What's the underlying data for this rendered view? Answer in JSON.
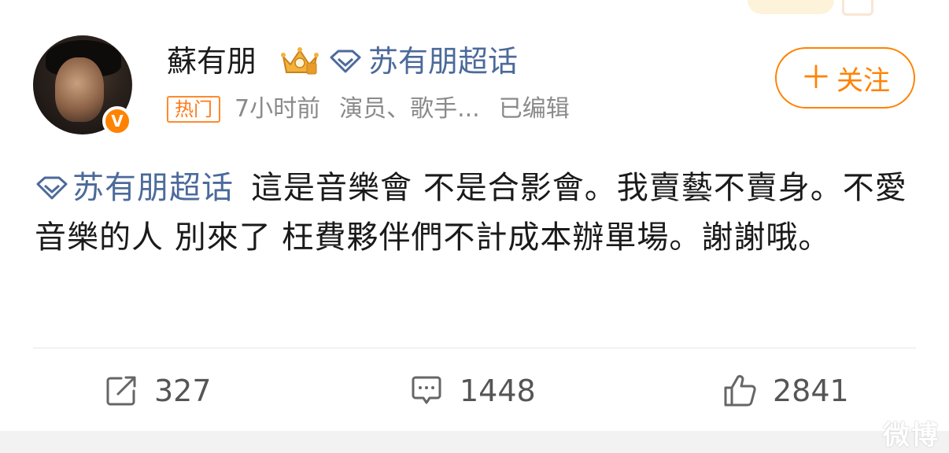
{
  "post": {
    "author": {
      "name": "蘇有朋",
      "verified_mark": "V",
      "avatar_icon": "avatar",
      "level_icon": "crown-icon"
    },
    "super_topic": {
      "label": "苏有朋超话",
      "icon": "diamond-icon"
    },
    "meta": {
      "hot_tag": "热门",
      "time": "7小时前",
      "description": "演员、歌手...",
      "edited": "已编辑"
    },
    "follow_button": {
      "plus": "＋",
      "label": "关注"
    },
    "content": {
      "topic_link": "苏有朋超话",
      "text": "這是音樂會 不是合影會。我賣藝不賣身。不愛音樂的人 別來了 枉費夥伴們不計成本辦單場。謝謝哦。"
    },
    "actions": {
      "repost_count": "327",
      "comment_count": "1448",
      "like_count": "2841"
    }
  },
  "watermark": "微博",
  "colors": {
    "accent_orange": "#ff8200",
    "topic_blue": "#4c6a9a",
    "text_dark": "#1a1a1a",
    "text_gray": "#8a8a8a"
  }
}
